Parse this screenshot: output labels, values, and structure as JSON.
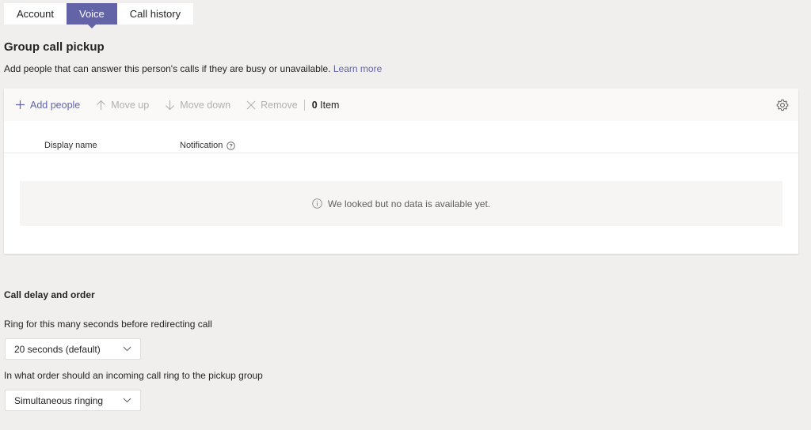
{
  "tabs": [
    {
      "label": "Account",
      "active": false
    },
    {
      "label": "Voice",
      "active": true
    },
    {
      "label": "Call history",
      "active": false
    }
  ],
  "section": {
    "title": "Group call pickup",
    "description": "Add people that can answer this person's calls if they are busy or unavailable.",
    "learn_more": "Learn more"
  },
  "toolbar": {
    "add_people": "Add people",
    "move_up": "Move up",
    "move_down": "Move down",
    "remove": "Remove",
    "item_count": "0",
    "item_label": "Item"
  },
  "table": {
    "columns": [
      "Display name",
      "Notification"
    ],
    "empty_message": "We looked but no data is available yet."
  },
  "delay_section": {
    "title": "Call delay and order",
    "ring_label": "Ring for this many seconds before redirecting call",
    "ring_value": "20 seconds (default)",
    "order_label": "In what order should an incoming call ring to the pickup group",
    "order_value": "Simultaneous ringing"
  },
  "colors": {
    "accent": "#6264a7",
    "background": "#f0efee",
    "disabled": "#b3b0ad"
  },
  "icons": {
    "add": "plus-icon",
    "move_up": "arrow-up-icon",
    "move_down": "arrow-down-icon",
    "remove": "close-icon",
    "settings": "gear-icon",
    "help": "question-circle-icon",
    "info": "info-circle-icon",
    "dropdown": "chevron-down-icon"
  }
}
